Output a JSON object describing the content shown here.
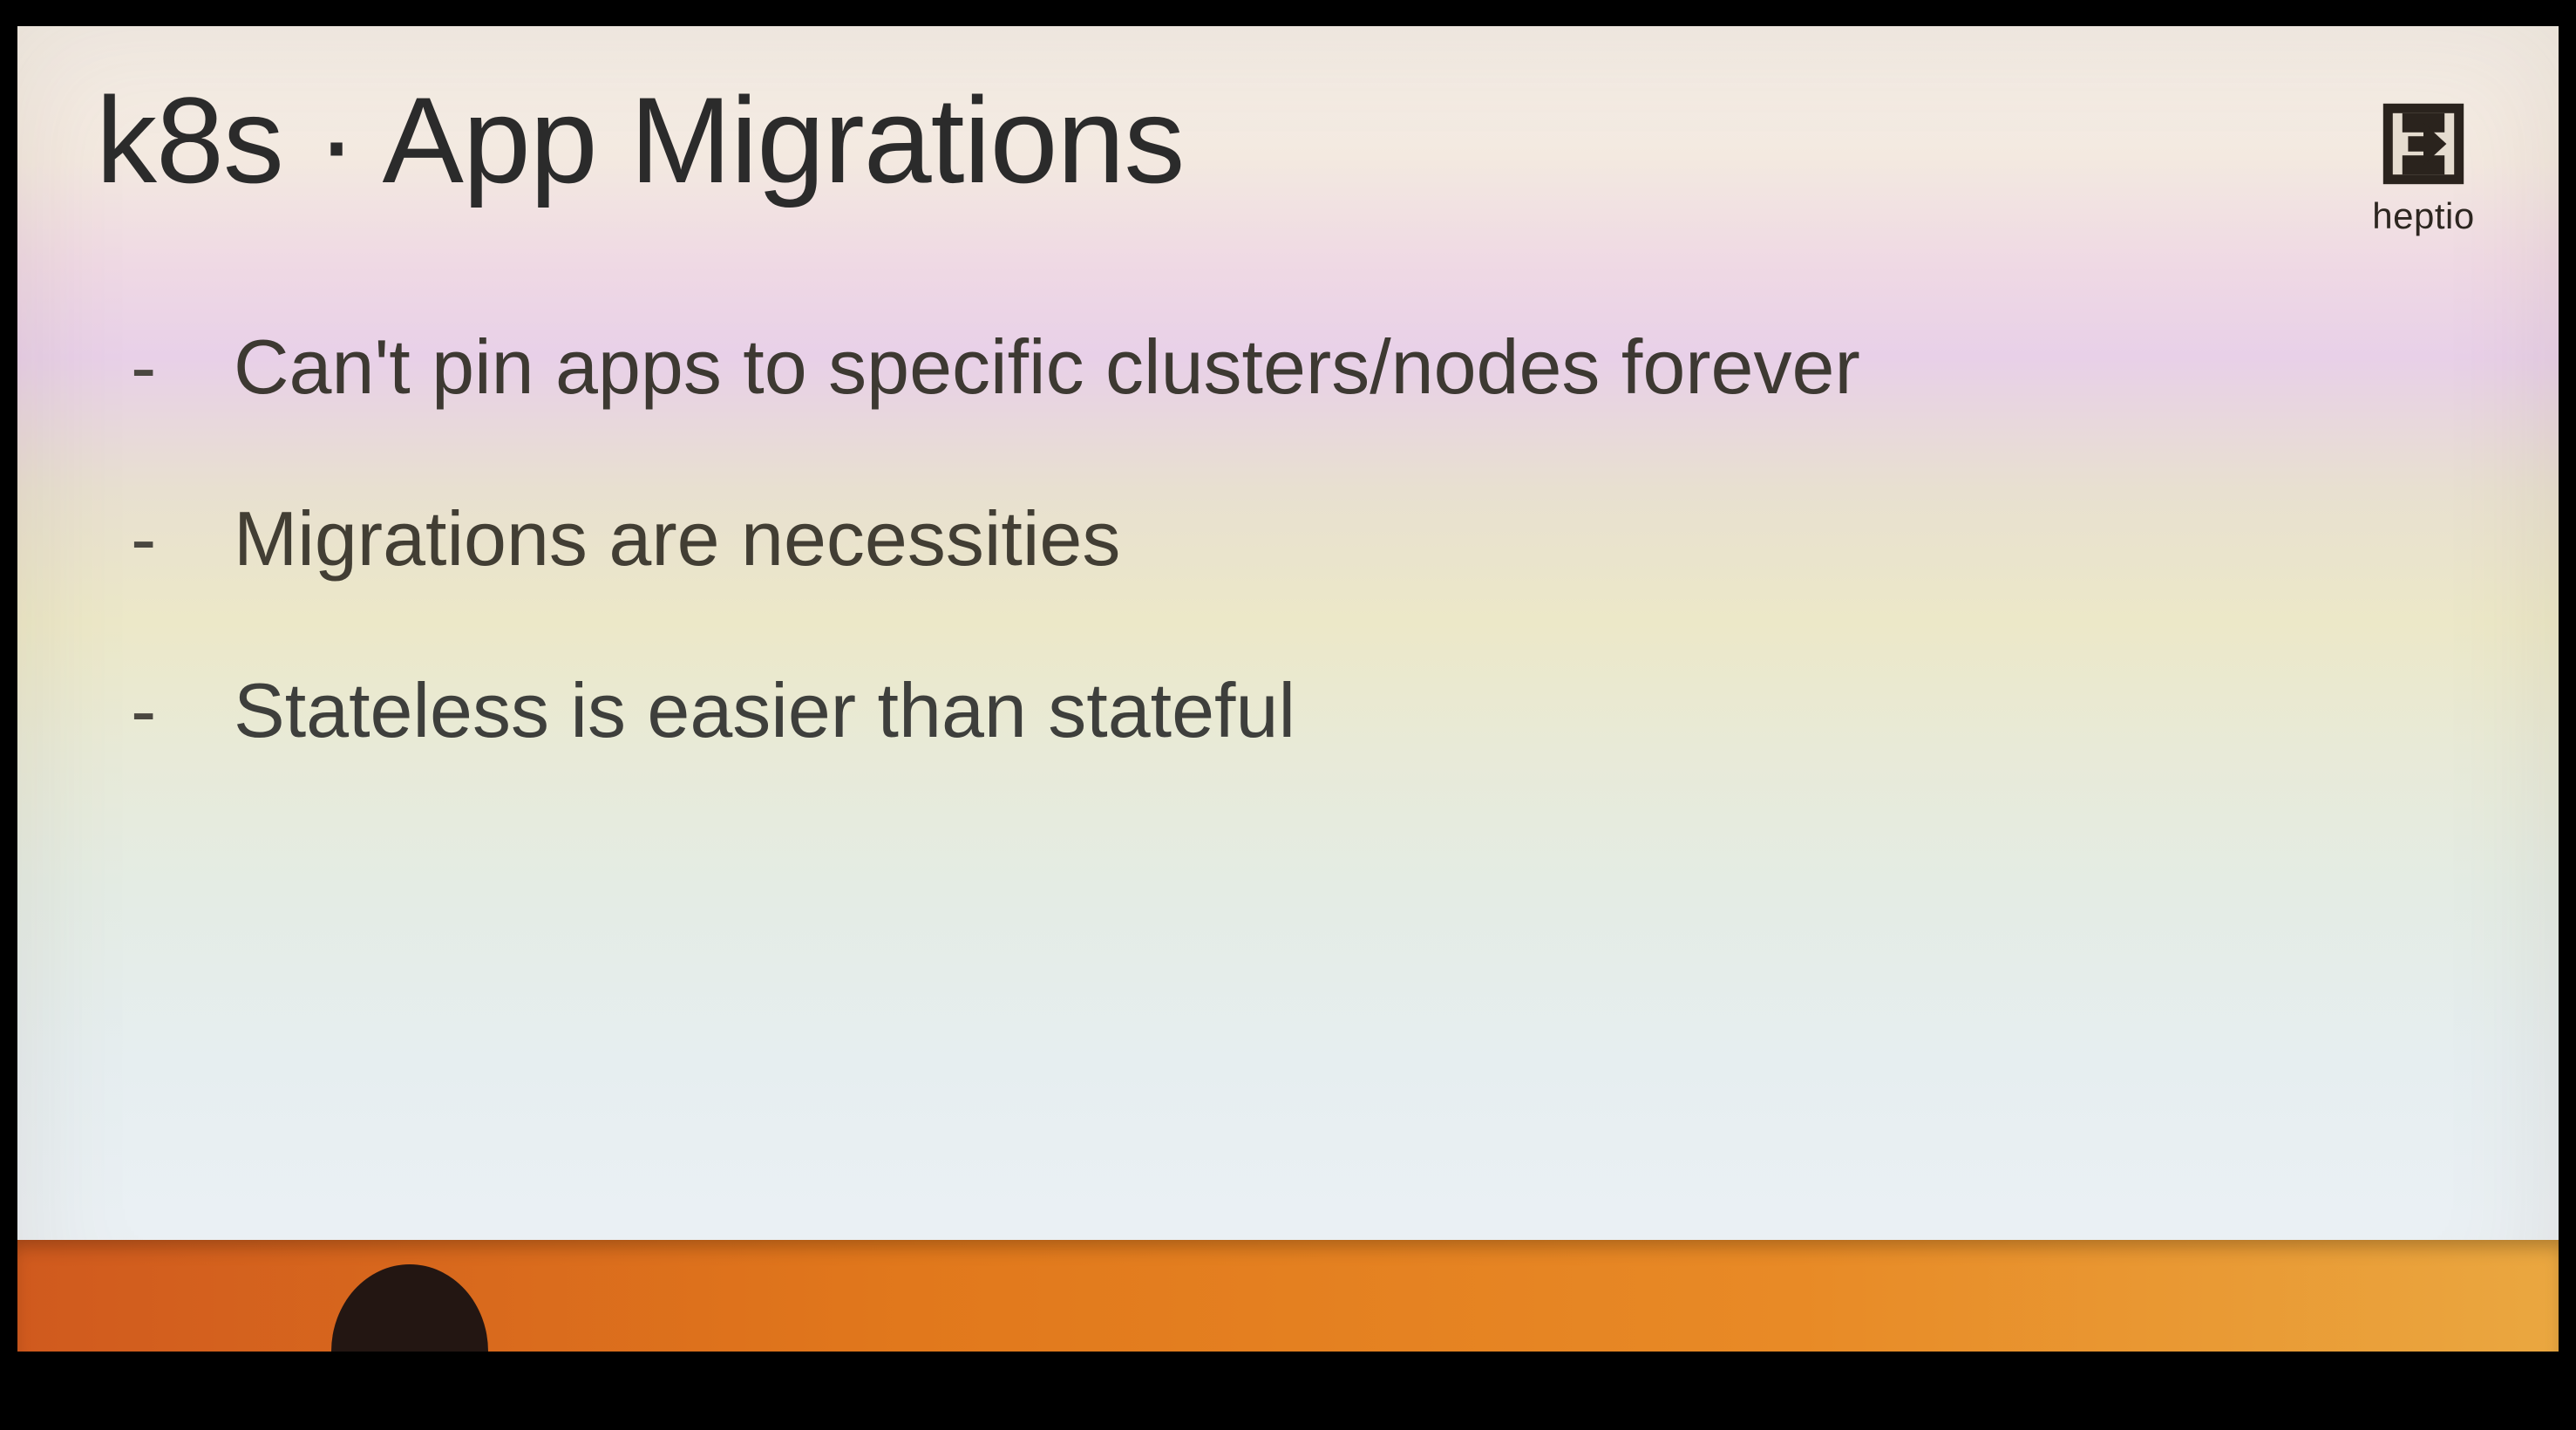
{
  "slide": {
    "title": "k8s · App Migrations",
    "bullets": [
      "Can't pin apps to specific clusters/nodes forever",
      "Migrations are necessities",
      "Stateless is easier than stateful"
    ],
    "logo_text": "heptio"
  }
}
